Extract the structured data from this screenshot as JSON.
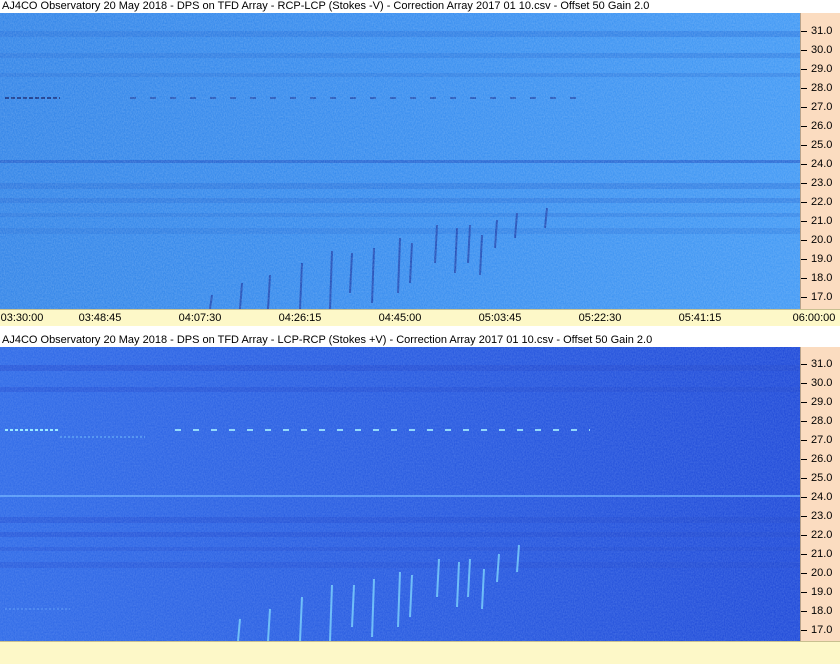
{
  "top_panel": {
    "title": "AJ4CO Observatory 20 May 2018  -  DPS on TFD Array  -  RCP-LCP (Stokes -V)  -  Correction Array 2017 01 10.csv  -  Offset 50  Gain 2.0",
    "background_color": "#2e86ee"
  },
  "bottom_panel": {
    "title": "AJ4CO Observatory 20 May 2018  -  DPS on TFD Array  -  LCP-RCP (Stokes +V)  -  Correction Array 2017 01 10.csv  -  Offset 50  Gain 2.0",
    "background_color": "#1f55e0"
  },
  "frequency_axis": {
    "labels": [
      "31.0",
      "30.0",
      "29.0",
      "28.0",
      "27.0",
      "26.0",
      "25.0",
      "24.0",
      "23.0",
      "22.0",
      "21.0",
      "20.0",
      "19.0",
      "18.0",
      "17.0"
    ]
  },
  "time_axis": {
    "labels": [
      "03:30:00",
      "03:48:45",
      "04:07:30",
      "04:26:15",
      "04:45:00",
      "05:03:45",
      "05:22:30",
      "05:41:15",
      "06:00:00"
    ]
  },
  "colors": {
    "axis_background": "#fbdcc0",
    "timebar_background": "#fdf8c8"
  }
}
